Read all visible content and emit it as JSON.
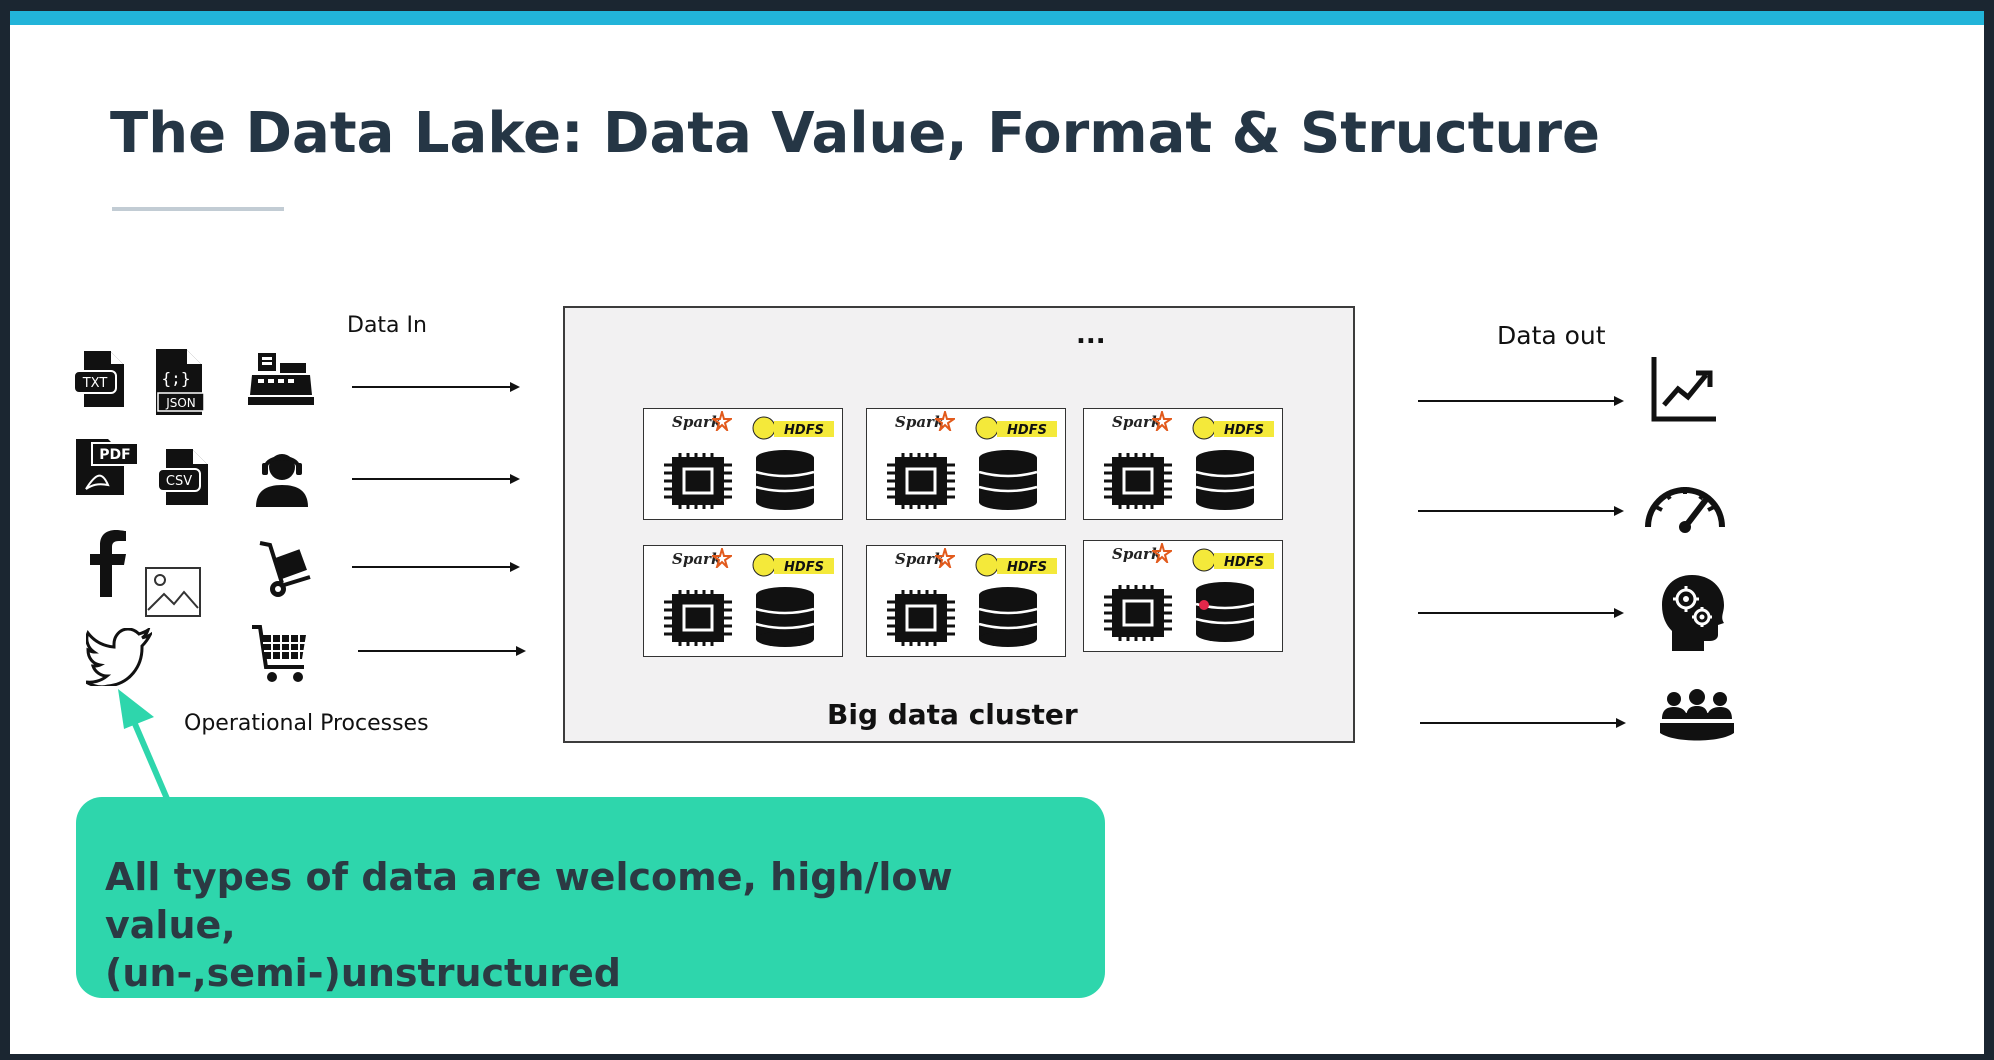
{
  "slide": {
    "title": "The Data Lake: Data Value, Format & Structure"
  },
  "inputs": {
    "data_in_label": "Data In",
    "operational_label": "Operational Processes",
    "file_icons": [
      "TXT",
      "{;}",
      "JSON",
      "PDF",
      "CSV"
    ]
  },
  "cluster": {
    "label": "Big data cluster",
    "ellipsis": "...",
    "node_spark_label": "Spark",
    "node_hdfs_label": "HDFS"
  },
  "outputs": {
    "data_out_label": "Data out"
  },
  "callout": {
    "text_line1": "All types of data are welcome, high/low value,",
    "text_line2": "(un-,semi-)unstructured"
  },
  "colors": {
    "accent_bar": "#22b4d9",
    "callout": "#2ed6ac",
    "hdfs_yellow": "#f4e93a",
    "title": "#253645"
  }
}
